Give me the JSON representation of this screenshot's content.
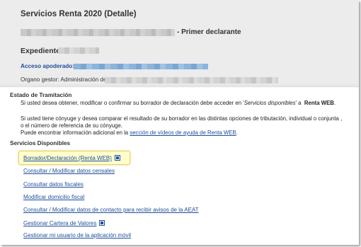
{
  "header": {
    "title": "Servicios Renta 2020 (Detalle)",
    "declarant_suffix": "- Primer declarante",
    "expediente_label": "Expediente",
    "acceso_label": "Acceso apoderado:",
    "organo_label": "Organo gestor: Administración de"
  },
  "estado": {
    "heading": "Estado de Tramitación",
    "line1_pre": "Si usted desea obtener, modificar o confirmar su borrador de declaración debe acceder en '",
    "line1_italic": "Servicios disponibles",
    "line1_mid": "' a ",
    "line1_bold": "Renta WEB",
    "line1_end": ".",
    "line2": "Si usted tiene cónyuge y desea comparar el resultado de su borrador en las distintas opciones de tributación, individual o conjunta ,",
    "line3": "o el número de referencia de su cónyuge.",
    "line4_pre": "Puede encontrar información adicional en la ",
    "line4_link": "sección de vídeos de ayuda de Renta WEB",
    "line4_end": "."
  },
  "servicios": {
    "heading": "Servicios Disponibles",
    "items": [
      {
        "label": "Borrador/Declaración (Renta WEB)",
        "external": true
      },
      {
        "label": "Consultar / Modificar datos censales",
        "external": false
      },
      {
        "label": "Consultar datos fiscales",
        "external": false
      },
      {
        "label": "Modificar domicilio fiscal",
        "external": false
      },
      {
        "label": "Consultar / Modificar datos de contacto para recibir avisos de la AEAT",
        "external": false
      },
      {
        "label": "Gestionar Cartera de Valores",
        "external": true
      },
      {
        "label": "Gestionar mi usuario de la aplicación móvil",
        "external": false
      }
    ]
  },
  "icons": {
    "external": "external-link-icon"
  },
  "colors": {
    "link": "#1f4e9a",
    "header_bg": "#ececec",
    "highlight": "#ffffcc"
  }
}
